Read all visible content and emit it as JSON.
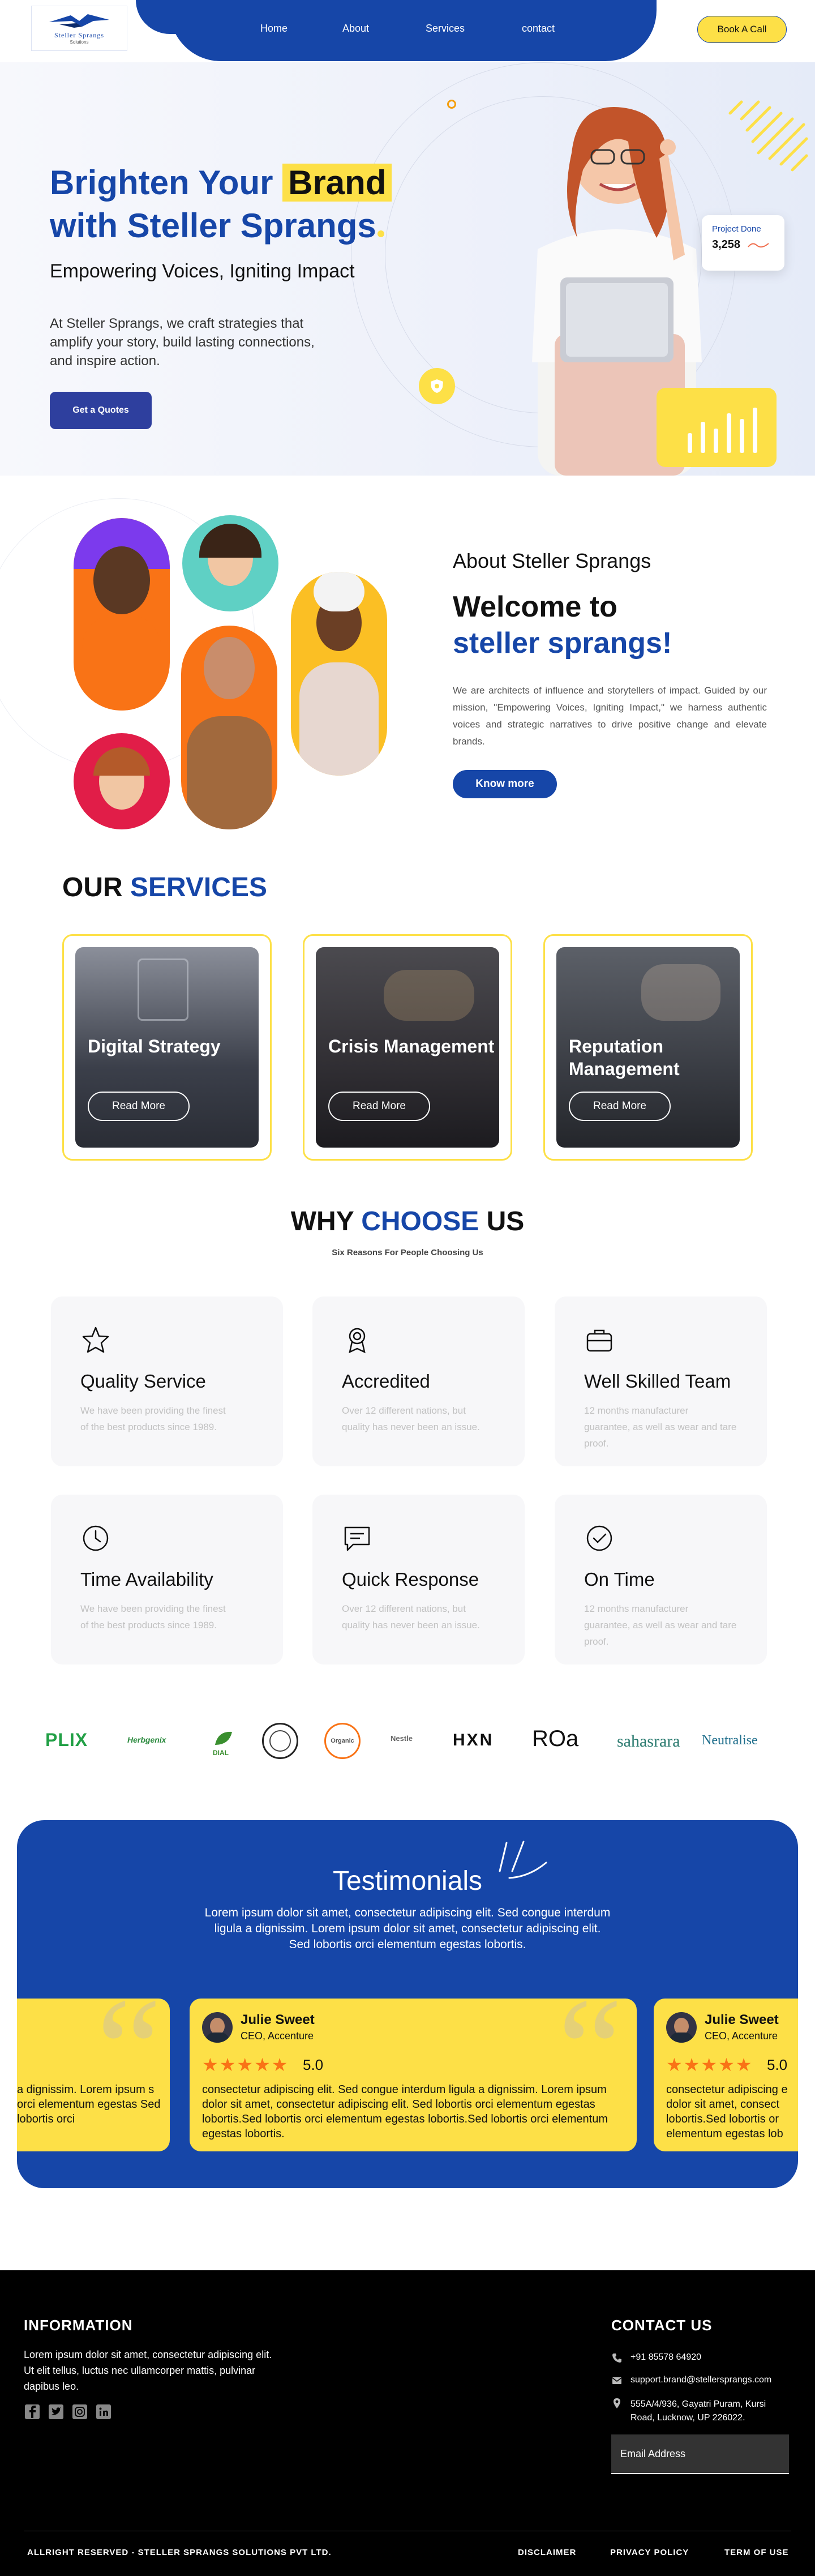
{
  "nav": {
    "logo_name": "Steller Sprangs",
    "logo_sub": "Solutions",
    "links": [
      "Home",
      "About",
      "Services",
      "contact"
    ],
    "cta": "Book A Call"
  },
  "hero": {
    "title_part1": "Brighten Your",
    "title_highlight": "Brand",
    "title_part2": "with Steller Sprangs",
    "subtitle": "Empowering Voices, Igniting Impact",
    "description": "At Steller Sprangs, we craft strategies that amplify your story, build lasting connections, and inspire action.",
    "cta": "Get a Quotes",
    "project_label": "Project Done",
    "project_value": "3,258"
  },
  "about": {
    "pre_title": "About Steller Sprangs",
    "title_line1": "Welcome to",
    "title_line2": "steller sprangs!",
    "description": "We are architects of influence and storytellers of impact. Guided by our mission, \"Empowering Voices, Igniting Impact,\" we harness authentic voices and strategic narratives to drive positive change and elevate brands.",
    "cta": "Know more"
  },
  "services": {
    "title_part1": "OUR",
    "title_part2": "SERVICES",
    "items": [
      {
        "title": "Digital Strategy",
        "cta": "Read More"
      },
      {
        "title": "Crisis Management",
        "cta": "Read More"
      },
      {
        "title": "Reputation Management",
        "cta": "Read More"
      }
    ]
  },
  "why": {
    "title_part1": "WHY",
    "title_part2": "CHOOSE",
    "title_part3": "US",
    "subtitle": "Six Reasons For People Choosing Us",
    "items": [
      {
        "icon": "star-icon",
        "title": "Quality Service",
        "desc": "We have been providing the finest of the best products since 1989."
      },
      {
        "icon": "award-icon",
        "title": "Accredited",
        "desc": "Over 12 different nations, but quality has never been an issue."
      },
      {
        "icon": "briefcase-icon",
        "title": "Well Skilled Team",
        "desc": "12 months manufacturer guarantee, as well as wear and tare proof."
      },
      {
        "icon": "clock-icon",
        "title": "Time Availability",
        "desc": "We have been providing the finest of the best products since 1989."
      },
      {
        "icon": "message-icon",
        "title": "Quick Response",
        "desc": "Over 12 different nations, but quality has never been an issue."
      },
      {
        "icon": "check-circle-icon",
        "title": "On Time",
        "desc": "12 months manufacturer guarantee, as well as wear and tare proof."
      }
    ]
  },
  "logos": [
    "PLIX",
    "Herbgenix",
    "DIAL",
    "",
    "Organic",
    "Nestle",
    "HXN",
    "ROa",
    "sahasrara",
    "Neutralise"
  ],
  "testimonials": {
    "title": "Testimonials",
    "description": "Lorem ipsum dolor sit amet, consectetur adipiscing elit. Sed congue interdum ligula a dignissim. Lorem ipsum dolor sit amet, consectetur adipiscing elit. Sed lobortis orci elementum egestas lobortis.",
    "partial_left_text": "a dignissim. Lorem ipsum s orci elementum egestas Sed lobortis orci",
    "cards": [
      {
        "name": "Julie Sweet",
        "role": "CEO, Accenture",
        "stars": "★★★★★",
        "rating": "5.0",
        "text": "consectetur adipiscing elit. Sed congue interdum ligula a dignissim. Lorem ipsum dolor sit amet, consectetur adipiscing elit. Sed lobortis orci elementum egestas lobortis.Sed lobortis orci elementum egestas lobortis.Sed lobortis orci elementum egestas lobortis."
      },
      {
        "name": "Julie Sweet",
        "role": "CEO, Accenture",
        "stars": "★★★★★",
        "rating": "5.0",
        "text": "consectetur adipiscing e dolor sit amet, consect lobortis.Sed lobortis or elementum egestas lob"
      }
    ]
  },
  "footer": {
    "info_title": "INFORMATION",
    "info_desc": "Lorem ipsum dolor sit amet, consectetur adipiscing elit. Ut elit tellus, luctus nec ullamcorper mattis, pulvinar dapibus leo.",
    "contact_title": "CONTACT US",
    "phone": "+91 85578 64920",
    "email": "support.brand@stellersprangs.com",
    "address": "555A/4/936, Gayatri Puram, Kursi Road, Lucknow, UP 226022.",
    "email_placeholder": "Email Address",
    "copyright": "ALLRIGHT RESERVED - STELLER SPRANGS SOLUTIONS PVT LTD.",
    "links": [
      "DISCLAIMER",
      "PRIVACY POLICY",
      "TERM OF USE"
    ]
  },
  "colors": {
    "primary": "#1646a8",
    "accent": "#fde047",
    "dark": "#000000"
  }
}
